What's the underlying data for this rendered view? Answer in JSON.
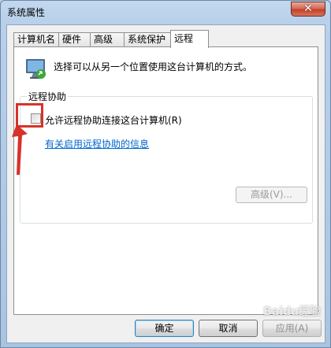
{
  "window": {
    "title": "系统属性",
    "close_label": "✕"
  },
  "tabs": [
    {
      "label": "计算机名",
      "active": false
    },
    {
      "label": "硬件",
      "active": false
    },
    {
      "label": "高级",
      "active": false
    },
    {
      "label": "系统保护",
      "active": false
    },
    {
      "label": "远程",
      "active": true
    }
  ],
  "remote": {
    "description": "选择可以从另一个位置使用这台计算机的方式。",
    "group_label": "远程协助",
    "allow_checkbox": {
      "label": "允许远程协助连接这台计算机(R)",
      "checked": false
    },
    "help_link": "有关启用远程协助的信息",
    "advanced_button": "高级(V)..."
  },
  "footer": {
    "ok_label": "确定",
    "cancel_label": "取消",
    "apply_label": "应用(A)"
  },
  "watermark": "Baidu经验",
  "colors": {
    "annotation": "#d7322a",
    "link": "#0066cc",
    "close_button": "#c2402b"
  }
}
